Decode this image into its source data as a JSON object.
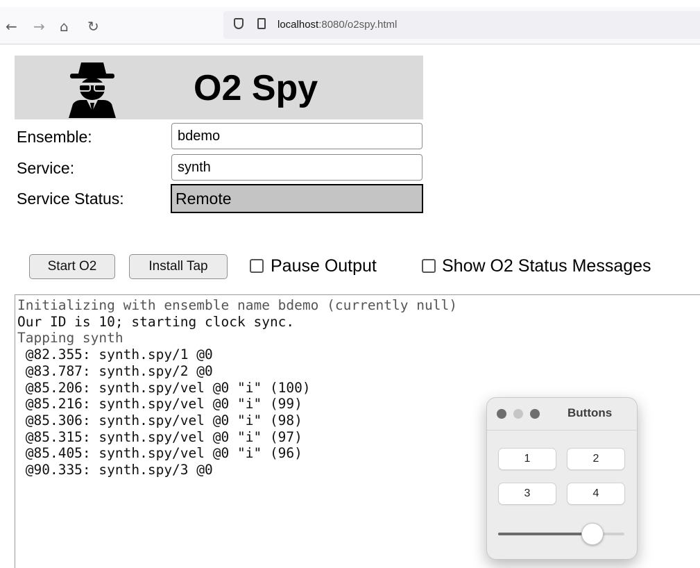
{
  "browser": {
    "back_icon": "←",
    "forward_icon": "→",
    "home_icon": "⌂",
    "reload_icon": "↻",
    "url_host": "localhost",
    "url_rest": ":8080/o2spy.html"
  },
  "header": {
    "title": "O2 Spy",
    "icon": "spy-icon"
  },
  "form": {
    "ensemble_label": "Ensemble:",
    "ensemble_value": "bdemo",
    "service_label": "Service:",
    "service_value": "synth",
    "status_label": "Service Status:",
    "status_value": "Remote"
  },
  "controls": {
    "start_label": "Start O2",
    "install_tap_label": "Install Tap",
    "pause_output_label": "Pause Output",
    "pause_output_checked": false,
    "show_status_label": "Show O2 Status Messages",
    "show_status_checked": false
  },
  "output": {
    "lines": [
      "Initializing with ensemble name bdemo (currently null)",
      "Our ID is 10; starting clock sync.",
      "Tapping synth",
      " @82.355: synth.spy/1 @0",
      " @83.787: synth.spy/2 @0",
      " @85.206: synth.spy/vel @0 \"i\" (100)",
      " @85.216: synth.spy/vel @0 \"i\" (99)",
      " @85.306: synth.spy/vel @0 \"i\" (98)",
      " @85.315: synth.spy/vel @0 \"i\" (97)",
      " @85.405: synth.spy/vel @0 \"i\" (96)",
      " @90.335: synth.spy/3 @0"
    ],
    "dim_lines": [
      0,
      2
    ]
  },
  "panel": {
    "title": "Buttons",
    "buttons": [
      "1",
      "2",
      "3",
      "4"
    ],
    "slider_fraction": 0.74,
    "dot_colors": [
      "#6e6e6e",
      "#c6c6c6",
      "#6e6e6e"
    ]
  }
}
